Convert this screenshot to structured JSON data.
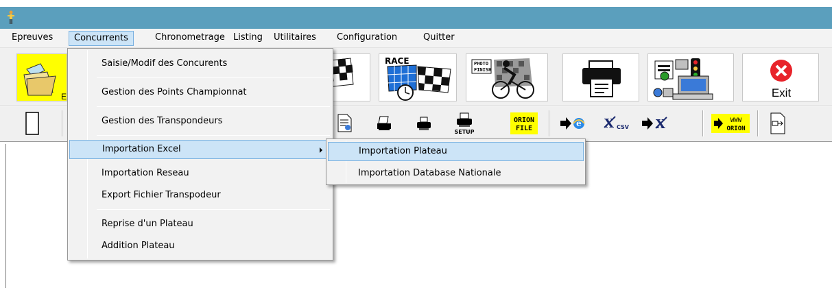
{
  "colors": {
    "titlebar": "#5b9fbd",
    "menu_highlight": "#cce4f7",
    "menu_highlight_border": "#7ab1e0",
    "exit_red": "#e8232a",
    "folder_yellow": "#ffff00"
  },
  "menubar": {
    "items": [
      {
        "label": "Epreuves"
      },
      {
        "label": "Concurrents"
      },
      {
        "label": "Chronometrage"
      },
      {
        "label": "Listing"
      },
      {
        "label": "Utilitaires"
      },
      {
        "label": "Configuration"
      },
      {
        "label": "Quitter"
      }
    ]
  },
  "toolbar1": {
    "items": [
      {
        "icon": "open-folder-icon",
        "label": "E"
      },
      {
        "icon": "checkered-flag-icon"
      },
      {
        "icon": "race-flag-clock-icon",
        "label": "RACE"
      },
      {
        "icon": "photo-finish-cyclist-icon",
        "label": "PHOTO FINISH"
      },
      {
        "icon": "printer-icon"
      },
      {
        "icon": "network-computer-icon"
      },
      {
        "icon": "exit-icon",
        "label": "Exit"
      }
    ]
  },
  "toolbar2": {
    "items": [
      {
        "icon": "blank-page-icon"
      },
      {
        "icon": "document-preview-icon"
      },
      {
        "icon": "print-list-icon"
      },
      {
        "icon": "printer-small-icon"
      },
      {
        "icon": "print-setup-icon",
        "label": "SETUP"
      },
      {
        "icon": "orion-file-icon",
        "label_line1": "ORION",
        "label_line2": "FILE"
      },
      {
        "icon": "internet-export-icon"
      },
      {
        "icon": "excel-csv-icon",
        "label": "CSV"
      },
      {
        "icon": "excel-export-icon"
      },
      {
        "icon": "www-orion-icon",
        "label_line1": "WWW",
        "label_line2": "ORION"
      },
      {
        "icon": "file-transfer-icon"
      }
    ]
  },
  "concurrents_menu": {
    "items": [
      {
        "label": "Saisie/Modif des Concurents"
      },
      {
        "label": "Gestion des Points Championnat"
      },
      {
        "label": "Gestion des Transpondeurs"
      },
      {
        "label": "Importation Excel"
      },
      {
        "label": "Importation Reseau"
      },
      {
        "label": "Export Fichier Transpodeur"
      },
      {
        "label": "Reprise d'un Plateau"
      },
      {
        "label": "Addition Plateau"
      }
    ]
  },
  "importation_excel_submenu": {
    "items": [
      {
        "label": "Importation Plateau"
      },
      {
        "label": "Importation Database Nationale"
      }
    ]
  }
}
